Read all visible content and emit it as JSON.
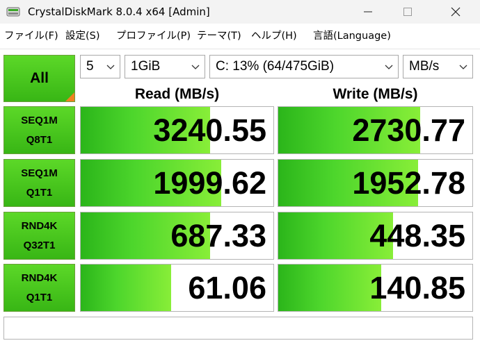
{
  "window": {
    "title": "CrystalDiskMark 8.0.4 x64 [Admin]"
  },
  "menu": [
    {
      "label": "ファイル(F)"
    },
    {
      "label": "設定(S)"
    },
    {
      "label": "プロファイル(P)"
    },
    {
      "label": "テーマ(T)"
    },
    {
      "label": "ヘルプ(H)"
    },
    {
      "label": "言語(Language)"
    }
  ],
  "controls": {
    "all_label": "All",
    "count": "5",
    "size": "1GiB",
    "drive": "C: 13% (64/475GiB)",
    "unit": "MB/s"
  },
  "headers": {
    "read": "Read (MB/s)",
    "write": "Write (MB/s)"
  },
  "tests": [
    {
      "line1": "SEQ1M",
      "line2": "Q8T1",
      "read": "3240.55",
      "write": "2730.77",
      "read_fill": 0.67,
      "write_fill": 0.73
    },
    {
      "line1": "SEQ1M",
      "line2": "Q1T1",
      "read": "1999.62",
      "write": "1952.78",
      "read_fill": 0.73,
      "write_fill": 0.72
    },
    {
      "line1": "RND4K",
      "line2": "Q32T1",
      "read": "687.33",
      "write": "448.35",
      "read_fill": 0.67,
      "write_fill": 0.59
    },
    {
      "line1": "RND4K",
      "line2": "Q1T1",
      "read": "61.06",
      "write": "140.85",
      "read_fill": 0.47,
      "write_fill": 0.53
    }
  ],
  "comment": "",
  "colors": {
    "button_green": "#46c41e",
    "bar_green": "#4dd62c",
    "corner_orange": "#f08020"
  }
}
